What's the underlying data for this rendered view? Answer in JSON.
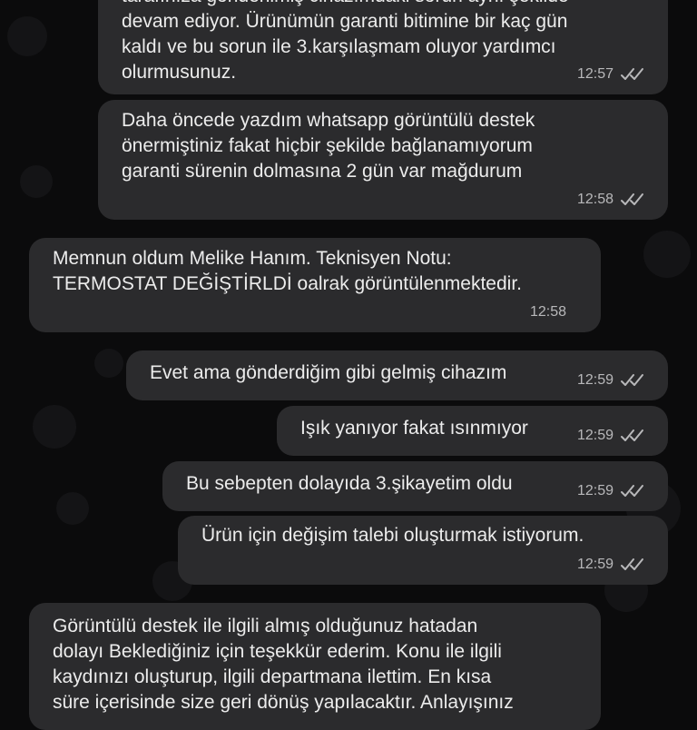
{
  "messages": [
    {
      "direction": "outgoing",
      "text": "tarafınıza gönderilmiş cihazımdaki sorun aynı şekilde\ndevam ediyor. Ürünümün garanti bitimine bir kaç gün\nkaldı ve bu sorun ile 3.karşılaşmam oluyor yardımcı\nolurmusunuz.",
      "time": "12:57",
      "status": "read-double-check-icon"
    },
    {
      "direction": "outgoing",
      "text": "Daha öncede yazdım whatsapp görüntülü destek\nönermiştiniz fakat hiçbir şekilde bağlanamıyorum\ngaranti sürenin dolmasına 2 gün var mağdurum",
      "time": "12:58",
      "status": "read-double-check-icon"
    },
    {
      "direction": "incoming",
      "text": "Memnun oldum Melike Hanım. Teknisyen Notu:\nTERMOSTAT DEĞİŞTİRLDİ oalrak görüntülenmektedir.",
      "time": "12:58"
    },
    {
      "direction": "outgoing",
      "text": "Evet ama gönderdiğim gibi gelmiş cihazım",
      "time": "12:59",
      "status": "read-double-check-icon"
    },
    {
      "direction": "outgoing",
      "text": "Işık yanıyor fakat ısınmıyor",
      "time": "12:59",
      "status": "read-double-check-icon"
    },
    {
      "direction": "outgoing",
      "text": "Bu sebepten dolayıda 3.şikayetim oldu",
      "time": "12:59",
      "status": "read-double-check-icon"
    },
    {
      "direction": "outgoing",
      "text": "Ürün için değişim talebi oluşturmak istiyorum.",
      "time": "12:59",
      "status": "read-double-check-icon"
    },
    {
      "direction": "incoming",
      "text": "Görüntülü destek ile ilgili almış olduğunuz hatadan\ndolayı Beklediğiniz için teşekkür ederim. Konu ile ilgili\nkaydınızı oluşturup, ilgili departmana ilettim. En kısa\nsüre içerisinde size geri dönüş yapılacaktır. Anlayışınız",
      "time": ""
    }
  ],
  "colors": {
    "background": "#0b0b0c",
    "bubble": "#2b2b2d",
    "text": "#ececec",
    "meta": "#b8b8ba"
  }
}
